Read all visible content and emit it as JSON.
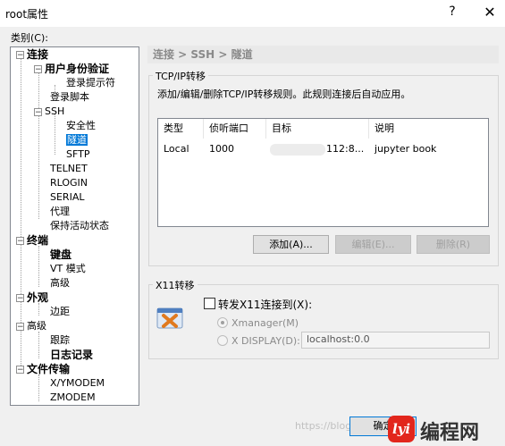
{
  "window": {
    "title": "root属性",
    "help": "?",
    "close": "✕"
  },
  "category_label": "类别(C):",
  "tree": {
    "items": [
      {
        "label": "连接",
        "exp": "−"
      },
      {
        "label": "用户身份验证",
        "exp": "−"
      },
      {
        "label": "登录提示符"
      },
      {
        "label": "登录脚本"
      },
      {
        "label": "SSH",
        "exp": "−"
      },
      {
        "label": "安全性"
      },
      {
        "label": "隧道"
      },
      {
        "label": "SFTP"
      },
      {
        "label": "TELNET"
      },
      {
        "label": "RLOGIN"
      },
      {
        "label": "SERIAL"
      },
      {
        "label": "代理"
      },
      {
        "label": "保持活动状态"
      },
      {
        "label": "终端",
        "exp": "−"
      },
      {
        "label": "键盘"
      },
      {
        "label": "VT 模式"
      },
      {
        "label": "高级"
      },
      {
        "label": "外观",
        "exp": "−"
      },
      {
        "label": "边距"
      },
      {
        "label": "高级",
        "exp": "−"
      },
      {
        "label": "跟踪"
      },
      {
        "label": "日志记录"
      },
      {
        "label": "文件传输",
        "exp": "−"
      },
      {
        "label": "X/YMODEM"
      },
      {
        "label": "ZMODEM"
      }
    ]
  },
  "breadcrumb": "连接 > SSH > 隧道",
  "tcpip": {
    "title": "TCP/IP转移",
    "description": "添加/编辑/删除TCP/IP转移规则。此规则连接后自动应用。",
    "columns": [
      "类型",
      "侦听端口",
      "目标",
      "说明"
    ],
    "rows": [
      {
        "type": "Local",
        "port": "1000",
        "target": "112:8...",
        "desc": "jupyter book"
      }
    ],
    "add_button": "添加(A)...",
    "edit_button": "编辑(E)...",
    "delete_button": "删除(R)"
  },
  "x11": {
    "title": "X11转移",
    "checkbox_label": "转发X11连接到(X):",
    "checked": false,
    "radio_xmanager": "Xmanager(M)",
    "radio_display": "X DISPLAY(D):",
    "display_value": "localhost:0.0"
  },
  "footer": {
    "ok_button": "确定",
    "watermark": "https://blog.csdn.net",
    "brand_logo": "lyi",
    "brand_text": "编程网"
  }
}
